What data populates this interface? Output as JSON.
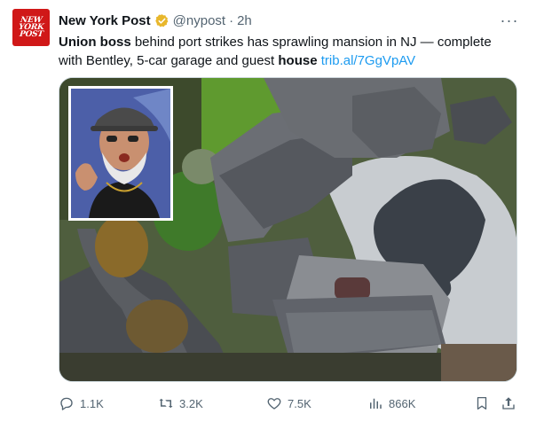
{
  "account": {
    "logo_lines": [
      "NEW",
      "YORK",
      "POST"
    ],
    "name": "New York Post",
    "handle": "@nypost",
    "separator": "·",
    "time": "2h",
    "verified_color": "#e8b72c"
  },
  "more_label": "···",
  "tweet": {
    "bold_1": "Union boss",
    "text_1": " behind port strikes has sprawling mansion in NJ — complete with Bentley, 5-car garage and guest ",
    "bold_2": "house",
    "space": " ",
    "link": "trib.al/7GgVpAV"
  },
  "media": {
    "main_image": "aerial-mansion-photo",
    "inset_image": "union-boss-portrait"
  },
  "actions": {
    "replies": "1.1K",
    "reposts": "3.2K",
    "likes": "7.5K",
    "views": "866K"
  },
  "colors": {
    "brand_red": "#d01818",
    "link_blue": "#1d9bf0",
    "muted": "#536471",
    "text": "#0f1419"
  }
}
